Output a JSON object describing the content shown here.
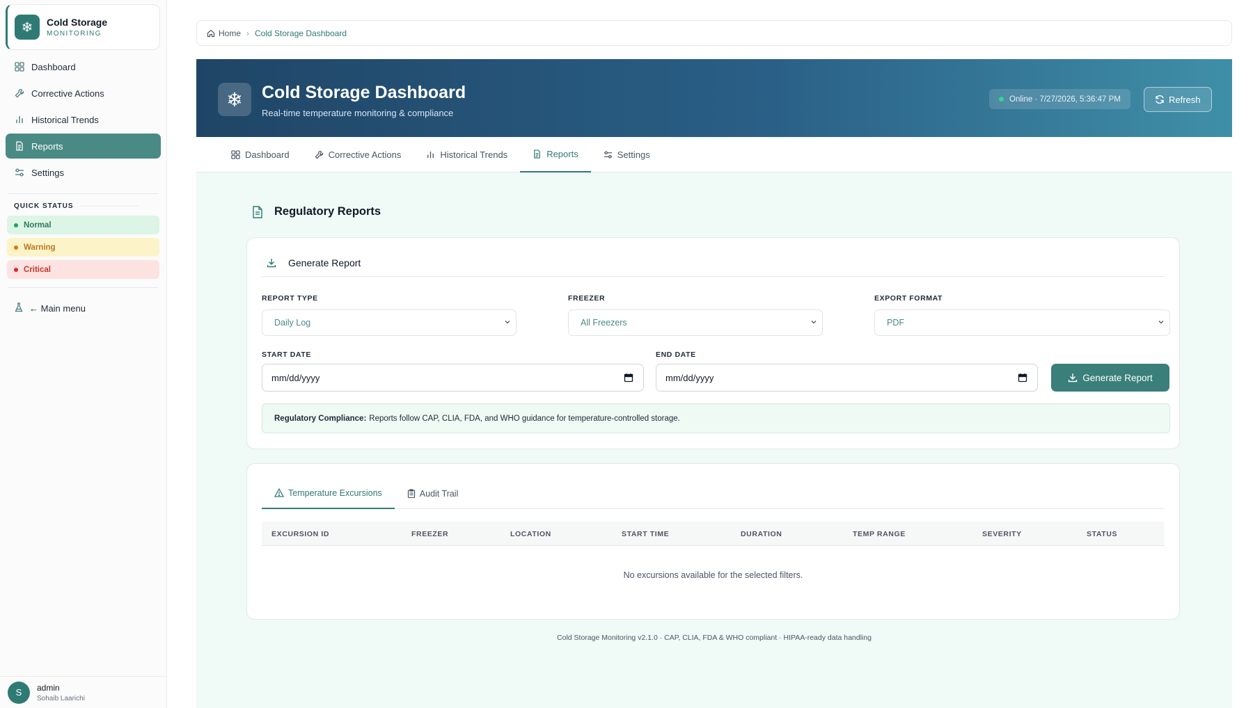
{
  "app": {
    "title": "Cold Storage",
    "subtitle": "MONITORING",
    "logo_icon": "snowflake-icon"
  },
  "sidebar": {
    "items": [
      {
        "label": "Dashboard",
        "icon": "grid-icon",
        "active": false
      },
      {
        "label": "Corrective Actions",
        "icon": "wrench-icon",
        "active": false
      },
      {
        "label": "Historical Trends",
        "icon": "bar-chart-icon",
        "active": false
      },
      {
        "label": "Reports",
        "icon": "document-icon",
        "active": true
      },
      {
        "label": "Settings",
        "icon": "sliders-icon",
        "active": false
      }
    ],
    "quick_status": {
      "heading": "QUICK STATUS",
      "items": [
        {
          "label": "Normal",
          "color": "#22a35a"
        },
        {
          "label": "Warning",
          "color": "#d97706"
        },
        {
          "label": "Critical",
          "color": "#dc2626"
        }
      ]
    },
    "main_menu_label": "← Main menu",
    "user": {
      "initial": "S",
      "name": "admin",
      "full_name": "Sohaib Laarichi"
    }
  },
  "breadcrumb": {
    "home": "Home",
    "current": "Cold Storage Dashboard"
  },
  "header": {
    "title": "Cold Storage Dashboard",
    "subtitle": "Real-time temperature monitoring & compliance",
    "status": "Online · 7/27/2026, 5:36:47 PM",
    "refresh_label": "Refresh"
  },
  "tabs": [
    {
      "label": "Dashboard",
      "icon": "grid-icon",
      "active": false
    },
    {
      "label": "Corrective Actions",
      "icon": "wrench-icon",
      "active": false
    },
    {
      "label": "Historical Trends",
      "icon": "bar-chart-icon",
      "active": false
    },
    {
      "label": "Reports",
      "icon": "document-icon",
      "active": true
    },
    {
      "label": "Settings",
      "icon": "sliders-icon",
      "active": false
    }
  ],
  "reports": {
    "title": "Regulatory Reports",
    "generate": {
      "heading": "Generate Report",
      "report_type_label": "REPORT TYPE",
      "report_type_value": "Daily Log",
      "freezer_label": "FREEZER",
      "freezer_value": "All Freezers",
      "export_label": "EXPORT FORMAT",
      "export_value": "PDF",
      "start_label": "START DATE",
      "start_placeholder": "mm/dd/yyyy",
      "end_label": "END DATE",
      "end_placeholder": "mm/dd/yyyy",
      "button_label": "Generate Report",
      "compliance_label": "Regulatory Compliance:",
      "compliance_text": "Reports follow CAP, CLIA, FDA, and WHO guidance for temperature-controlled storage."
    },
    "subtabs": [
      {
        "label": "Temperature Excursions",
        "icon": "warning-triangle-icon",
        "active": true
      },
      {
        "label": "Audit Trail",
        "icon": "clipboard-icon",
        "active": false
      }
    ],
    "table": {
      "columns": [
        "EXCURSION ID",
        "FREEZER",
        "LOCATION",
        "START TIME",
        "DURATION",
        "TEMP RANGE",
        "SEVERITY",
        "STATUS"
      ],
      "empty_message": "No excursions available for the selected filters."
    }
  },
  "footer": "Cold Storage Monitoring v2.1.0 · CAP, CLIA, FDA & WHO compliant · HIPAA-ready data handling",
  "colors": {
    "accent": "#2f7a74",
    "header_gradient_start": "#1f4566",
    "header_gradient_end": "#3f8fa8",
    "content_bg": "#f0faf6"
  }
}
